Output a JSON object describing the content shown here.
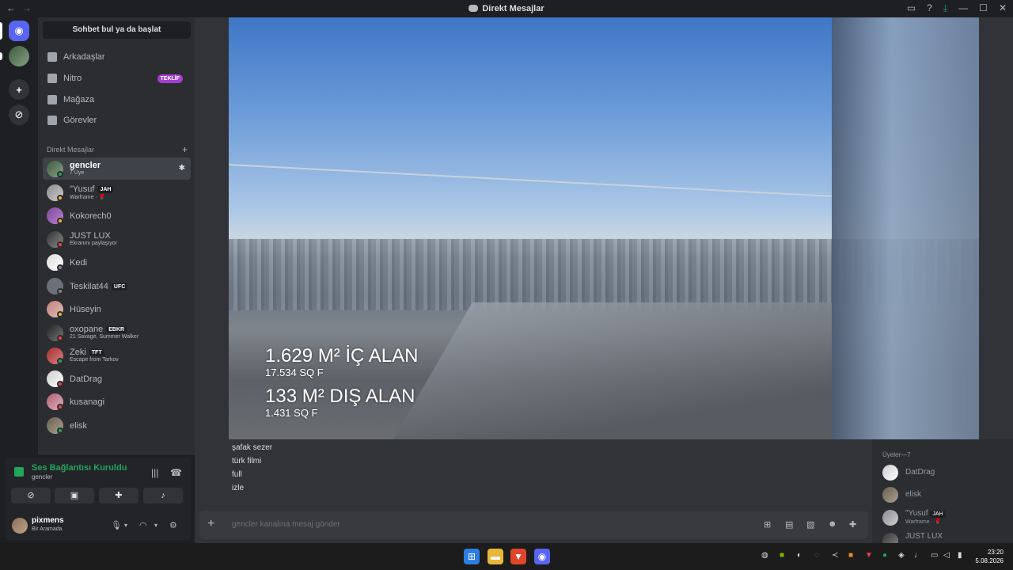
{
  "window": {
    "title": "Direkt Mesajlar"
  },
  "sidebar": {
    "search": "Sohbet bul ya da başlat",
    "nav": [
      {
        "label": "Arkadaşlar"
      },
      {
        "label": "Nitro",
        "badge": "TEKLİF"
      },
      {
        "label": "Mağaza"
      },
      {
        "label": "Görevler"
      }
    ],
    "dm_header": "Direkt Mesajlar",
    "dms": [
      {
        "name": "gencler",
        "sub": "7 Üye"
      },
      {
        "name": "\"Yusuf",
        "tag": "JAH",
        "sub": "Warframe · 🌹"
      },
      {
        "name": "Kokorech0"
      },
      {
        "name": "JUST LUX",
        "sub": "Ekranını paylaşıyor"
      },
      {
        "name": "Kedi"
      },
      {
        "name": "Teskilat44",
        "tag": "UFC"
      },
      {
        "name": "Hüseyin"
      },
      {
        "name": "oxopane",
        "tag": "EBKR",
        "sub": "21 Savage, Summer Walker"
      },
      {
        "name": "Zeki",
        "tag": "TFT",
        "sub": "Escape from Tarkov"
      },
      {
        "name": "DatDrag"
      },
      {
        "name": "kusanagi"
      },
      {
        "name": "elisk"
      }
    ]
  },
  "voice": {
    "status": "Ses Bağlantısı Kuruldu",
    "channel": "gencler"
  },
  "user": {
    "name": "pixmens",
    "status": "Bir Aramada"
  },
  "video": {
    "line1": "1.629 M² İÇ ALAN",
    "line2": "17.534 SQ F",
    "line3": "133 M² DIŞ ALAN",
    "line4": "1.431 SQ F"
  },
  "messages": [
    "şafak sezer",
    "türk filmi",
    "full",
    "izle"
  ],
  "composer": {
    "placeholder": "gencler kanalına mesaj gönder"
  },
  "members": {
    "header": "Üyeler—7",
    "list": [
      {
        "name": "DatDrag"
      },
      {
        "name": "elisk"
      },
      {
        "name": "\"Yusuf",
        "tag": "JAH",
        "sub": "Warframe · 🌹"
      },
      {
        "name": "JUST LUX"
      }
    ]
  },
  "clock": {
    "time": "23:20",
    "date": "5.08.2026"
  },
  "colors": {
    "accent": "#5865f2",
    "online": "#23a55a",
    "dnd": "#f23f43",
    "idle": "#f0b232"
  }
}
